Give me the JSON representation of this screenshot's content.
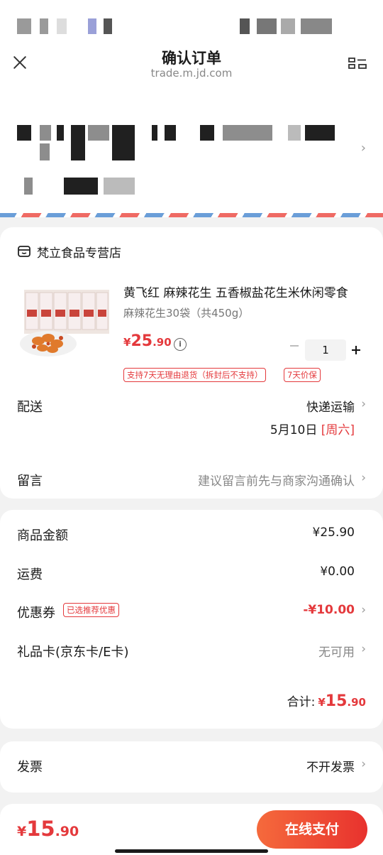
{
  "header": {
    "title": "确认订单",
    "url": "trade.m.jd.com"
  },
  "store": {
    "name": "梵立食品专营店"
  },
  "product": {
    "title": "黄飞红 麻辣花生 五香椒盐花生米休闲零食",
    "spec": "麻辣花生30袋（共450g）",
    "price_currency": "¥",
    "price_int": "25",
    "price_dec": ".90",
    "info_icon": "i",
    "quantity": "1",
    "tags": [
      "支持7天无理由退货（拆封后不支持）",
      "7天价保"
    ]
  },
  "delivery": {
    "label": "配送",
    "method": "快递运输",
    "date": "5月10日",
    "weekday": "[周六]"
  },
  "message": {
    "label": "留言",
    "placeholder": "建议留言前先与商家沟通确认"
  },
  "summary": {
    "goods_label": "商品金额",
    "goods_value": "¥25.90",
    "shipping_label": "运费",
    "shipping_value": "¥0.00",
    "coupon_label": "优惠券",
    "coupon_tag": "已选推荐优惠",
    "coupon_value": "-¥10.00",
    "giftcard_label": "礼品卡(京东卡/E卡)",
    "giftcard_value": "无可用",
    "total_label": "合计:",
    "total_currency": "¥",
    "total_int": "15",
    "total_dec": ".90"
  },
  "invoice": {
    "label": "发票",
    "value": "不开发票"
  },
  "bottom": {
    "currency": "¥",
    "int": "15",
    "dec": ".90",
    "pay_label": "在线支付"
  },
  "icons": {
    "chevron": "›"
  },
  "colors": {
    "accent_red": "#e4393c",
    "pay_gradient_start": "#f56a3c",
    "pay_gradient_end": "#e8322e"
  }
}
